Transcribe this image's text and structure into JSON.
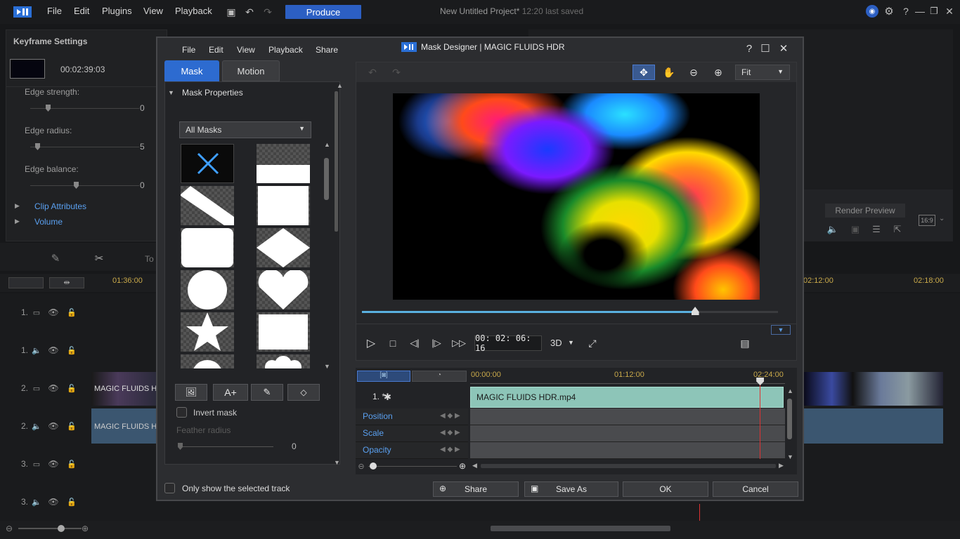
{
  "app": {
    "menu": [
      "File",
      "Edit",
      "Plugins",
      "View",
      "Playback"
    ],
    "produce_label": "Produce",
    "project_title": "New Untitled Project*",
    "saved_status": "12:20 last saved"
  },
  "keyframe": {
    "title": "Keyframe Settings",
    "timecode": "00:02:39:03",
    "edge_strength_label": "Edge strength:",
    "edge_strength_value": "0",
    "edge_radius_label": "Edge radius:",
    "edge_radius_value": "5",
    "edge_balance_label": "Edge balance:",
    "edge_balance_value": "0",
    "clip_attributes": "Clip Attributes",
    "volume": "Volume"
  },
  "right_panel": {
    "render_preview": "Render Preview",
    "aspect": "16:9"
  },
  "timeline": {
    "ruler": [
      "01:36:00",
      "02:12:00",
      "02:18:00"
    ],
    "tracks": [
      {
        "num": "1."
      },
      {
        "num": "1."
      },
      {
        "num": "2."
      },
      {
        "num": "2."
      },
      {
        "num": "3."
      },
      {
        "num": "3."
      }
    ],
    "clip_label": "MAGIC FLUIDS H",
    "tools_label": "To"
  },
  "dialog": {
    "menu": [
      "File",
      "Edit",
      "View",
      "Playback",
      "Share"
    ],
    "title": "Mask Designer  |  MAGIC FLUIDS HDR",
    "tabs": [
      "Mask",
      "Motion"
    ],
    "section": "Mask Properties",
    "dropdown": "All Masks",
    "invert_label": "Invert mask",
    "feather_label": "Feather radius",
    "feather_value": "0",
    "zoom": "Fit",
    "timecode": "00: 02: 06: 16",
    "mode_3d": "3D",
    "kf_ruler": [
      "00:00:00",
      "01:12:00",
      "02:24:00"
    ],
    "track_label": "1.  *",
    "clip_name": "MAGIC FLUIDS HDR.mp4",
    "props": [
      "Position",
      "Scale",
      "Opacity"
    ],
    "only_selected": "Only show the selected track",
    "share": "Share",
    "save_as": "Save As",
    "ok": "OK",
    "cancel": "Cancel",
    "playhead_progress": 0.92,
    "preview_progress": 0.8
  },
  "colors": {
    "accent": "#2c5fc3",
    "clip": "#8dc5b8",
    "playhead": "#d33",
    "label_blue": "#5aa0f0"
  }
}
